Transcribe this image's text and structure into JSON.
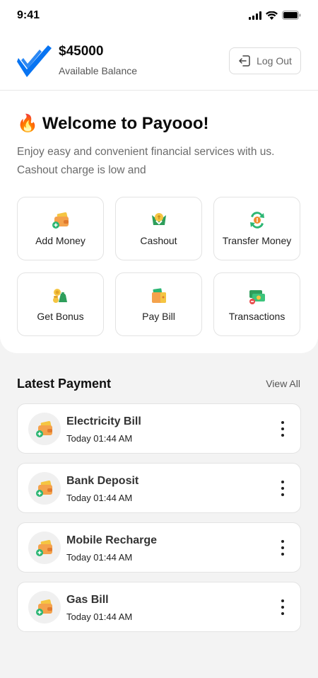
{
  "status_bar": {
    "time": "9:41",
    "icons": [
      "signal-icon",
      "wifi-icon",
      "battery-icon"
    ]
  },
  "header": {
    "balance": "$45000",
    "balance_label": "Available Balance",
    "logout_label": "Log Out"
  },
  "welcome": {
    "emoji": "🔥",
    "title": "Welcome to Payooo!",
    "subtitle": "Enjoy easy and convenient financial services with us. Cashout charge is low and"
  },
  "actions": [
    {
      "label": "Add Money",
      "icon": "wallet-add-icon"
    },
    {
      "label": "Cashout",
      "icon": "cashout-icon"
    },
    {
      "label": "Transfer Money",
      "icon": "transfer-icon"
    },
    {
      "label": "Get Bonus",
      "icon": "bonus-icon"
    },
    {
      "label": "Pay Bill",
      "icon": "bill-icon"
    },
    {
      "label": "Transactions",
      "icon": "transactions-icon"
    }
  ],
  "latest": {
    "title": "Latest Payment",
    "view_all": "View All",
    "items": [
      {
        "name": "Electricity Bill",
        "time": "Today 01:44 AM"
      },
      {
        "name": "Bank Deposit",
        "time": "Today 01:44 AM"
      },
      {
        "name": "Mobile Recharge",
        "time": "Today 01:44 AM"
      },
      {
        "name": "Gas Bill",
        "time": "Today 01:44 AM"
      }
    ]
  },
  "colors": {
    "brand": "#0874f2",
    "background": "#f3f3f3",
    "card": "#ffffff"
  }
}
